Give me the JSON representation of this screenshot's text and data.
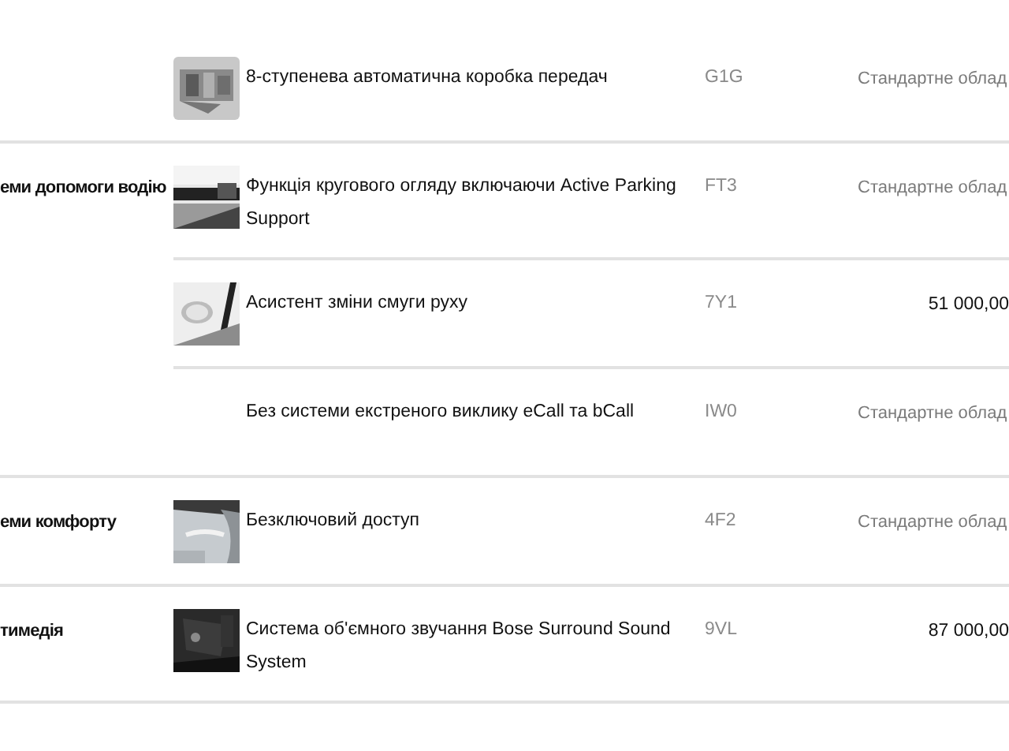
{
  "groups": [
    {
      "items": [
        {
          "name": "8-ступенева автоматична коробка передач",
          "code": "G1G",
          "price": {
            "kind": "standard",
            "text": "Стандартне облад"
          }
        }
      ]
    },
    {
      "category": "еми допомоги водію",
      "items": [
        {
          "name": "Функція кругового огляду включаючи Active Parking Support",
          "code": "FT3",
          "price": {
            "kind": "standard",
            "text": "Стандартне облад"
          }
        },
        {
          "name": "Асистент зміни смуги руху",
          "code": "7Y1",
          "price": {
            "kind": "amount",
            "text": "51 000,00"
          }
        },
        {
          "name": "Без системи екстреного виклику eCall та bCall",
          "code": "IW0",
          "price": {
            "kind": "standard",
            "text": "Стандартне облад"
          }
        }
      ]
    },
    {
      "category": "еми комфорту",
      "items": [
        {
          "name": "Безключовий доступ",
          "code": "4F2",
          "price": {
            "kind": "standard",
            "text": "Стандартне облад"
          }
        }
      ]
    },
    {
      "category": "тимедія",
      "items": [
        {
          "name": "Система об'ємного звучання Bose Surround Sound System",
          "code": "9VL",
          "price": {
            "kind": "amount",
            "text": "87 000,00"
          }
        }
      ]
    }
  ]
}
